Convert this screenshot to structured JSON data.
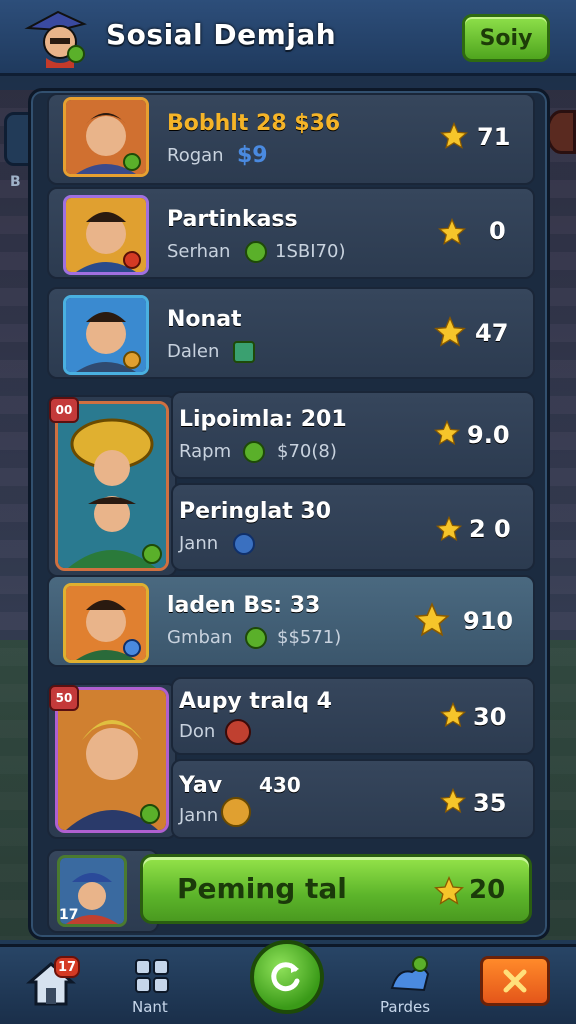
{
  "header": {
    "title": "Sosial Demjah",
    "button_label": "Soiy"
  },
  "side": {
    "left_label": "B"
  },
  "rows": [
    {
      "name": "Bobhlt 28 $36",
      "sub": "Rogan",
      "sub_extra": "$9",
      "score": "71",
      "highlight": false
    },
    {
      "name": "Partinkass",
      "sub": "Serhan",
      "sub_extra": "1SBI70)",
      "score": "0",
      "highlight": false
    },
    {
      "name": "Nonat",
      "sub": "Dalen",
      "sub_extra": "",
      "score": "47",
      "highlight": false
    },
    {
      "name": "Lipoimla: 201",
      "sub": "Rapm",
      "sub_extra": "$70(8)",
      "score": "9.0",
      "highlight": false
    },
    {
      "name": "Peringlat 30",
      "sub": "Jann",
      "sub_extra": "",
      "score": "2 0",
      "highlight": false
    },
    {
      "name": "laden Bs: 33",
      "sub": "Gmban",
      "sub_extra": "$$571)",
      "score": "910",
      "highlight": true
    },
    {
      "name": "Aupy tralq 4",
      "sub": "Don",
      "sub_extra": "",
      "score": "30",
      "highlight": false
    },
    {
      "name": "Yav",
      "name_extra": "430",
      "sub": "Jann",
      "sub_extra": "",
      "score": "35",
      "highlight": false
    }
  ],
  "card_badges": {
    "a": "00",
    "b": "50"
  },
  "cta": {
    "label": "Peming tal",
    "score": "20",
    "avatar_badge": "17"
  },
  "bottom_nav": {
    "home_badge": "17",
    "item2_label": "Nant",
    "item4_label": "Pardes"
  },
  "colors": {
    "gold": "#f5b428",
    "green": "#5cb42a",
    "panel": "#1b2b40"
  }
}
